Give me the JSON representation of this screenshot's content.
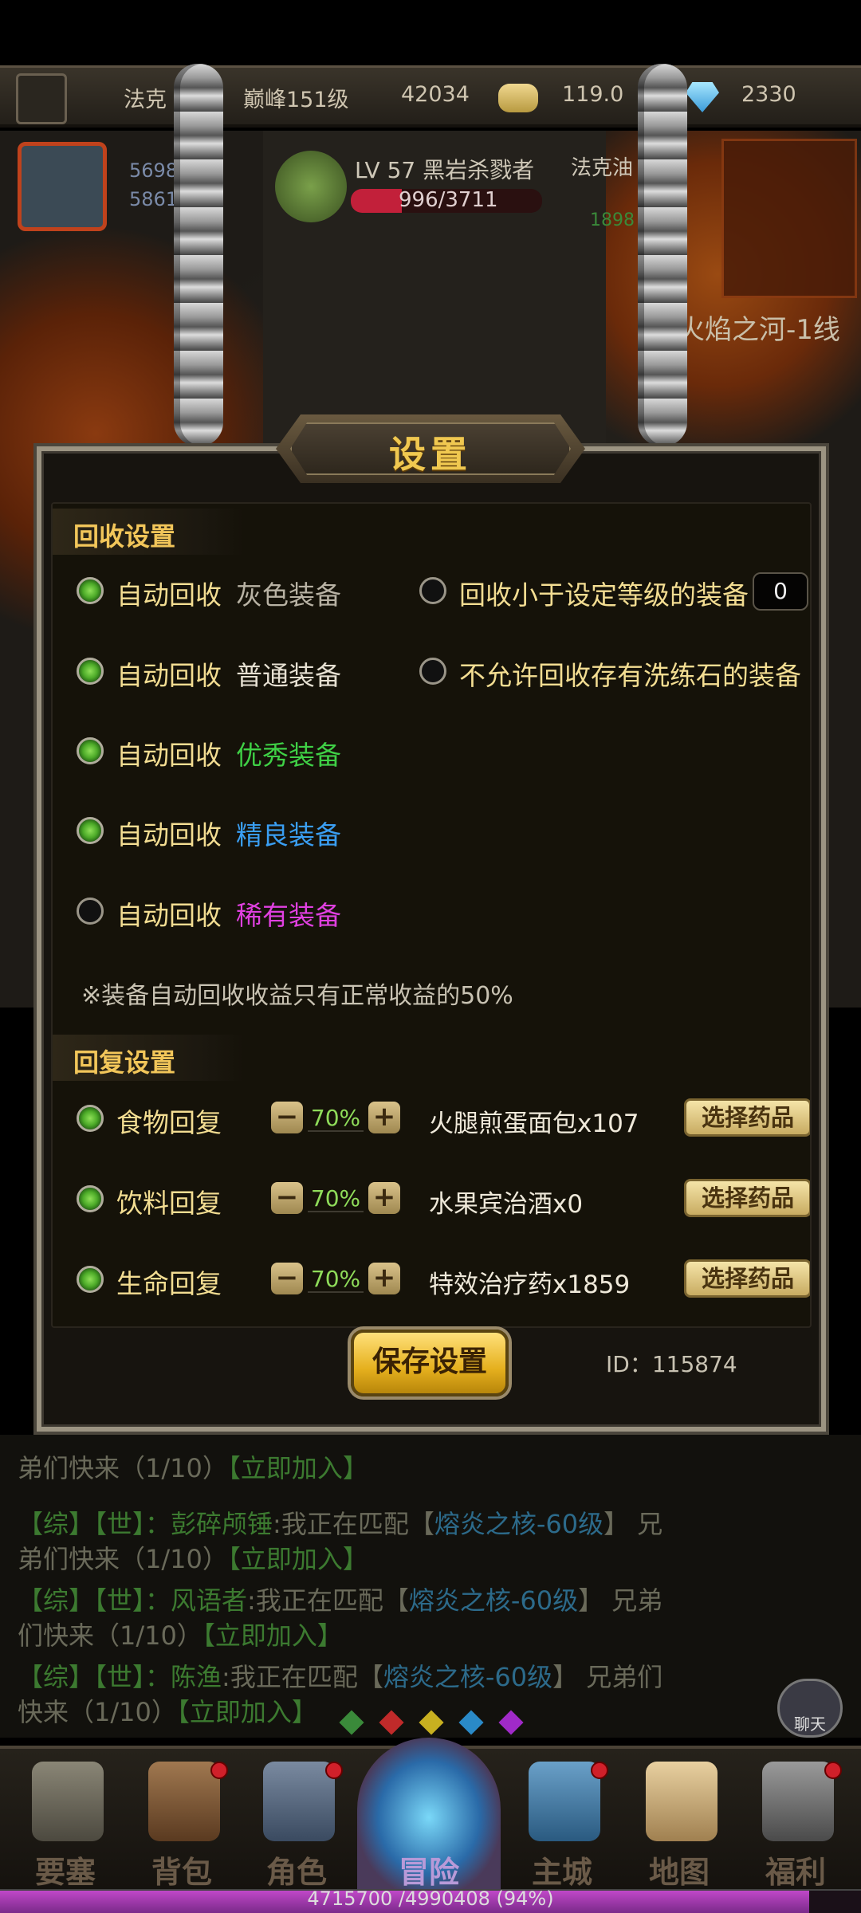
{
  "hud": {
    "player_name": "法克",
    "peak_level": "巅峰151级",
    "gold": "42034",
    "energy": "119.0",
    "diamonds": "2330"
  },
  "world": {
    "hero_stat_1": "5698",
    "hero_stat_2": "5861",
    "target_name": "LV 57 黑岩杀戮者",
    "target_hp": "996/3711",
    "target_hp_fraction": 0.268,
    "ally_name": "法克油",
    "ally_stat": "1898",
    "zone": "火焰之河-1线"
  },
  "dialog": {
    "title": "设置",
    "recycle_section": "回收设置",
    "auto_recycle_label": "自动回收",
    "recycle_items": [
      {
        "label": "自动回收",
        "value": "灰色装备",
        "color": "#b8b2a4",
        "checked": true
      },
      {
        "label": "自动回收",
        "value": "普通装备",
        "color": "#e6e0d2",
        "checked": true
      },
      {
        "label": "自动回收",
        "value": "优秀装备",
        "color": "#3fd046",
        "checked": true
      },
      {
        "label": "自动回收",
        "value": "精良装备",
        "color": "#3a9ef2",
        "checked": true
      },
      {
        "label": "自动回收",
        "value": "稀有装备",
        "color": "#e040e0",
        "checked": false
      }
    ],
    "recycle_below_level": "回收小于设定等级的装备",
    "level_value": "0",
    "no_recycle_wash_stone": "不允许回收存有洗练石的装备",
    "note": "※装备自动回收收益只有正常收益的50%",
    "restore_section": "回复设置",
    "restore_items": [
      {
        "label": "食物回复",
        "percent": "70%",
        "potion": "火腿煎蛋面包x107",
        "button": "选择药品",
        "checked": true
      },
      {
        "label": "饮料回复",
        "percent": "70%",
        "potion": "水果宾治酒x0",
        "button": "选择药品",
        "checked": true
      },
      {
        "label": "生命回复",
        "percent": "70%",
        "potion": "特效治疗药x1859",
        "button": "选择药品",
        "checked": true
      }
    ],
    "save_button": "保存设置",
    "id_text": "ID：115874"
  },
  "chat": {
    "lines": [
      {
        "a": "弟们快来（1/10）",
        "b": "【立即加入】"
      },
      {
        "a": "【综】【世】：",
        "name": "彭碎颅锤",
        "c": ":我正在匹配【",
        "d": "熔炎之核-60级",
        "e": "】 兄",
        "f": "弟们快来（1/10）",
        "g": "【立即加入】"
      },
      {
        "a": "【综】【世】：",
        "name": "风语者",
        "c": ":我正在匹配【",
        "d": "熔炎之核-60级",
        "e": "】 兄弟",
        "f": "们快来（1/10）",
        "g": "【立即加入】"
      },
      {
        "a": "【综】【世】：",
        "name": "陈渔",
        "c": ":我正在匹配【",
        "d": "熔炎之核-60级",
        "e": "】 兄弟们",
        "f": "快来（1/10）",
        "g": "【立即加入】"
      }
    ],
    "chat_button": "聊天"
  },
  "nav": {
    "items": [
      "要塞",
      "背包",
      "角色",
      "冒险",
      "主城",
      "地图",
      "福利"
    ]
  },
  "xp": {
    "text": "4715700 /4990408 (94%)",
    "fraction": 0.94
  }
}
